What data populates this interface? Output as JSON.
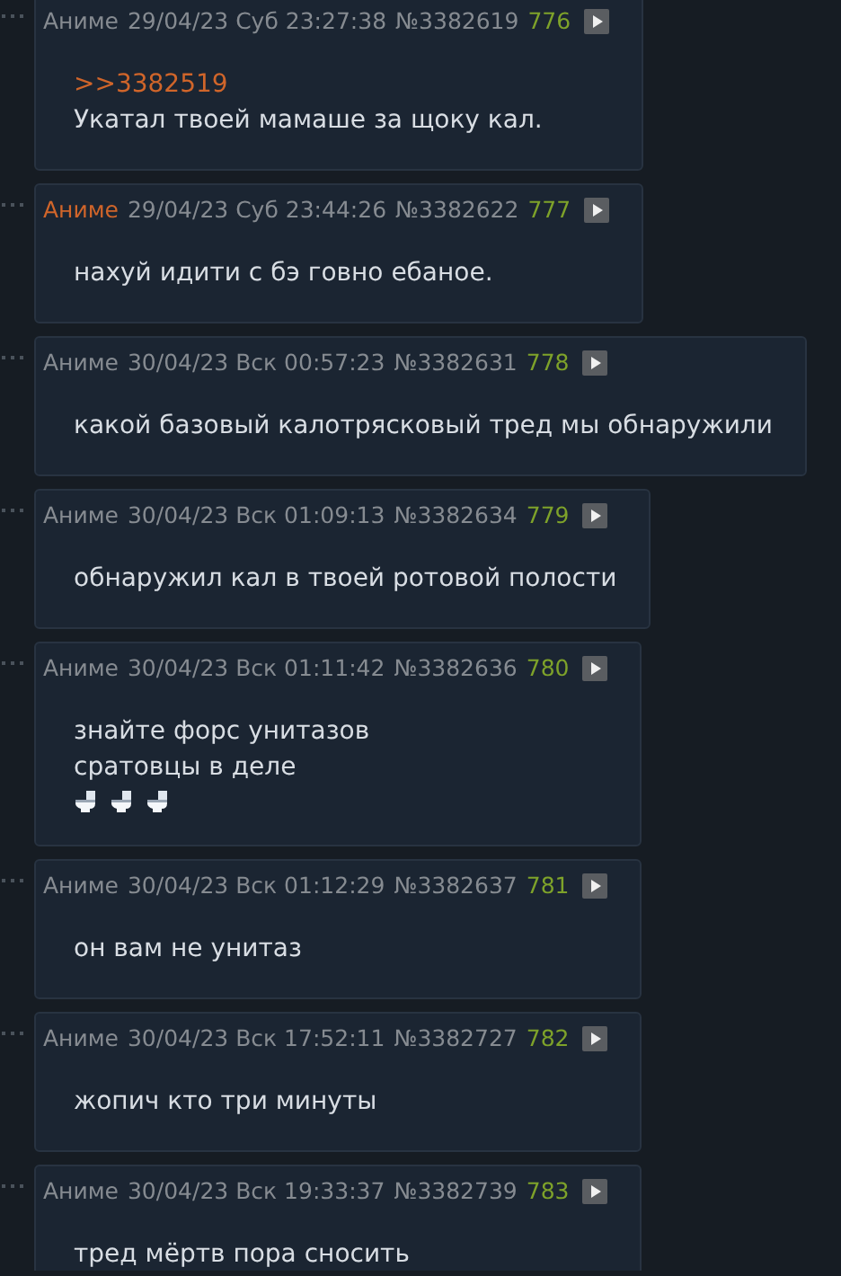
{
  "posts": [
    {
      "name": "Аниме",
      "op": false,
      "date": "29/04/23 Суб 23:27:38",
      "number": "№3382619",
      "count": "776",
      "reply_link": ">>3382519",
      "lines": [
        "Укатал твоей мамаше за щоку кал."
      ]
    },
    {
      "name": "Аниме",
      "op": true,
      "date": "29/04/23 Суб 23:44:26",
      "number": "№3382622",
      "count": "777",
      "lines": [
        "нахуй идити с бэ говно ебаное."
      ]
    },
    {
      "name": "Аниме",
      "op": false,
      "date": "30/04/23 Вск 00:57:23",
      "number": "№3382631",
      "count": "778",
      "lines": [
        "какой базовый калотрясковый тред мы обнаружили"
      ]
    },
    {
      "name": "Аниме",
      "op": false,
      "date": "30/04/23 Вск 01:09:13",
      "number": "№3382634",
      "count": "779",
      "lines": [
        "обнаружил кал в твоей ротовой полости"
      ]
    },
    {
      "name": "Аниме",
      "op": false,
      "date": "30/04/23 Вск 01:11:42",
      "number": "№3382636",
      "count": "780",
      "lines": [
        "знайте форс унитазов",
        "сратовцы в деле"
      ],
      "icons": [
        {
          "kind": "toilet"
        },
        {
          "kind": "toilet"
        },
        {
          "kind": "toilet"
        }
      ]
    },
    {
      "name": "Аниме",
      "op": false,
      "date": "30/04/23 Вск 01:12:29",
      "number": "№3382637",
      "count": "781",
      "lines": [
        "он вам не унитаз"
      ]
    },
    {
      "name": "Аниме",
      "op": false,
      "date": "30/04/23 Вск 17:52:11",
      "number": "№3382727",
      "count": "782",
      "lines": [
        "жопич кто три минуты"
      ]
    },
    {
      "name": "Аниме",
      "op": false,
      "date": "30/04/23 Вск 19:33:37",
      "number": "№3382739",
      "count": "783",
      "lines": [
        "тред мёртв пора сносить"
      ]
    }
  ]
}
